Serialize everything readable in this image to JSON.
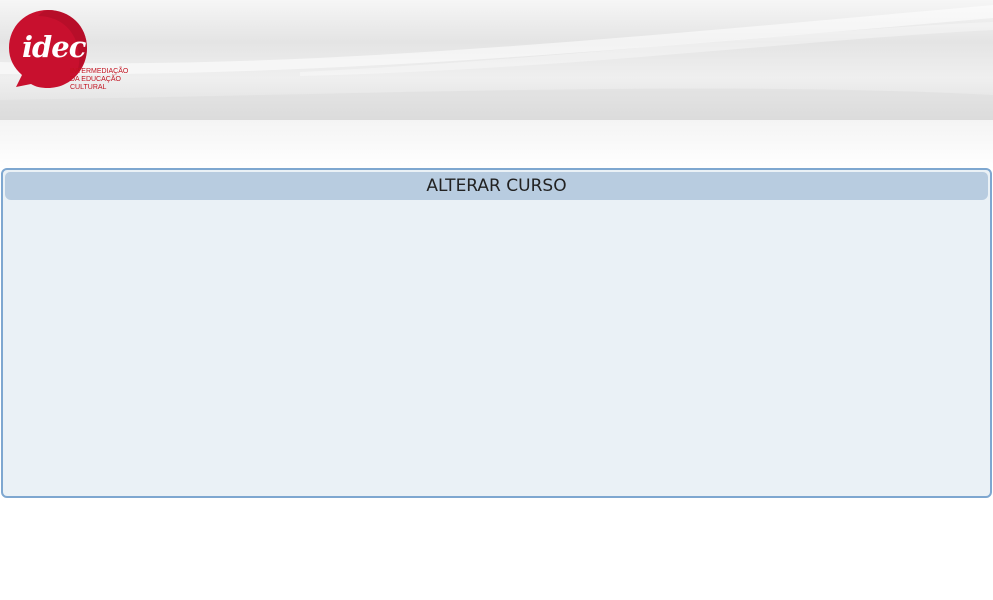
{
  "header": {
    "logo": {
      "brand": "idec",
      "tagline": "INTERMEDIAÇÃO\nDA EDUCAÇÃO\nCULTURAL",
      "color": "#c1121f"
    }
  },
  "panel": {
    "title": "ALTERAR CURSO",
    "header_color": "#b8cce0",
    "border_color": "#7ea7d0",
    "background_color": "#eaf1f6"
  }
}
